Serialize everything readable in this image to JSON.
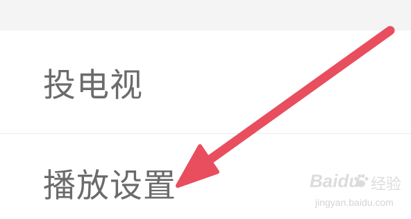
{
  "menu": {
    "items": [
      {
        "label": "投电视"
      },
      {
        "label": "播放设置"
      }
    ]
  },
  "annotation": {
    "arrow_color": "#e84e5e",
    "arrow_icon": "red-pointer-arrow-icon"
  },
  "watermark": {
    "logo_text": "Baidu",
    "secondary_text": "经验",
    "url": "jingyan.baidu.com"
  }
}
